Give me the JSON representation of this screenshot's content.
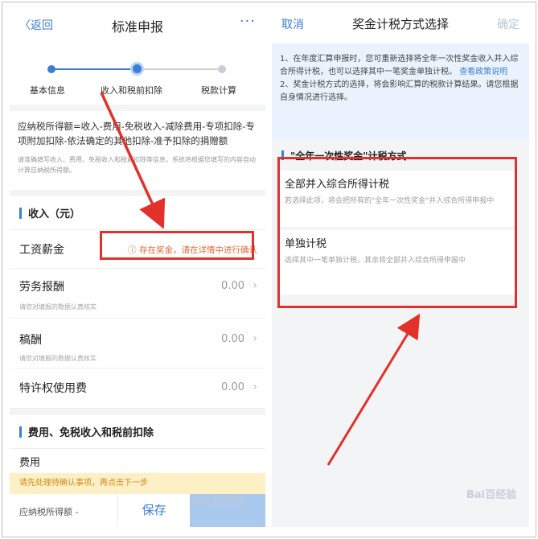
{
  "left": {
    "nav": {
      "back": "〈返回",
      "title": "标准申报",
      "more": "···"
    },
    "steps": [
      "基本信息",
      "收入和税前扣除",
      "税款计算"
    ],
    "formula": {
      "main": "应纳税所得额=收入-费用-免税收入-减除费用-专项扣除-专项附加扣除-依法确定的其他扣除-准予扣除的捐赠额",
      "note": "请准确填写收入、费用、免税收入和税前扣除等信息，系统将根据您填写的内容自动计算应纳税所得额。"
    },
    "income_section": "收入（元）",
    "rows": [
      {
        "name": "工资薪金",
        "warning": "ⓘ 存在奖金，请在详情中进行确认",
        "value": "",
        "hint": ""
      },
      {
        "name": "劳务报酬",
        "value": "0.00",
        "hint": "请您对填报的数据认真核实"
      },
      {
        "name": "稿酬",
        "value": "0.00",
        "hint": "请您对填报的数据认真核实"
      },
      {
        "name": "特许权使用费",
        "value": "0.00",
        "hint": ""
      }
    ],
    "expense_section": "费用、免税收入和税前扣除",
    "expense_row": "费用",
    "yellow_notice": "请先处理待确认事项，再点击下一步",
    "bottom": {
      "tax_label": "应纳税所得额 -",
      "save": "保存"
    }
  },
  "right": {
    "nav": {
      "cancel": "取消",
      "title": "奖金计税方式选择",
      "confirm": "确定"
    },
    "notice_1": "1、在年度汇算申报时，您可重新选择将全年一次性奖金收入并入综合所得计税，也可以选择其中一笔奖金单独计税。",
    "notice_link": "查看政策说明",
    "notice_2": "2、奖金计税方式的选择，将会影响汇算的税款计算结果。请您根据自身情况进行选择。",
    "section": "\"全年一次性奖金\"计税方式",
    "options": [
      {
        "title": "全部并入综合所得计税",
        "desc": "若选择此项，将会把所有的\"全年一次性奖金\"并入综合所得申报中"
      },
      {
        "title": "单独计税",
        "desc": "选择其中一笔单独计税，其余将全部并入综合所得申报中"
      }
    ]
  },
  "watermark": "Bai百经验",
  "colors": {
    "accent": "#3a7fd5",
    "annotation_red": "#e2302a",
    "warning": "#e06a3c"
  }
}
